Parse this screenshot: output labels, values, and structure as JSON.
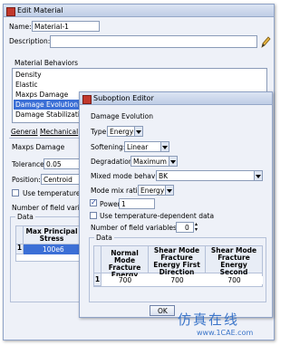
{
  "edit_material": {
    "title": "Edit Material",
    "name_label": "Name:",
    "name_value": "Material-1",
    "description_label": "Description:",
    "behaviors_label": "Material Behaviors",
    "behaviors": [
      "Density",
      "Elastic",
      "Maxps Damage",
      "Damage Evolution",
      "Damage Stabilization"
    ],
    "selected_behavior": "Damage Evolution",
    "menus": [
      "General",
      "Mechanical"
    ],
    "section_title": "Maxps Damage",
    "tolerance_label": "Tolerance:",
    "tolerance_value": "0.05",
    "position_label": "Position:",
    "position_value": "Centroid",
    "temp_label": "Use temperature-de",
    "field_vars_label": "Number of field variab",
    "data_label": "Data",
    "table_header": "Max Principal Stress",
    "table_row_index": "1",
    "table_value": "100e6"
  },
  "suboption": {
    "title": "Suboption Editor",
    "section_title": "Damage Evolution",
    "type_label": "Type:",
    "type_value": "Energy",
    "softening_label": "Softening:",
    "softening_value": "Linear",
    "degradation_label": "Degradation:",
    "degradation_value": "Maximum",
    "mixed_mode_label": "Mixed mode behavior:",
    "mixed_mode_value": "BK",
    "mode_mix_label": "Mode mix ratio:",
    "mode_mix_value": "Energy",
    "power_label": "Power",
    "power_value": "1",
    "temp_label": "Use temperature-dependent data",
    "field_vars_label": "Number of field variables:",
    "field_vars_value": "0",
    "data_label": "Data",
    "columns": [
      "Normal Mode Fracture Energy",
      "Shear Mode Fracture Energy First Direction",
      "Shear Mode Fracture Energy Second Direction"
    ],
    "row_index": "1",
    "row_values": [
      "700",
      "700",
      "700"
    ],
    "ok_label": "OK"
  },
  "watermark": {
    "text_cn": "仿真在线",
    "url": "www.1CAE.com"
  },
  "colors": {
    "selection": "#3b6fd6",
    "title_gradient": "#c6d3ea",
    "watermark": "#3b75c9"
  }
}
